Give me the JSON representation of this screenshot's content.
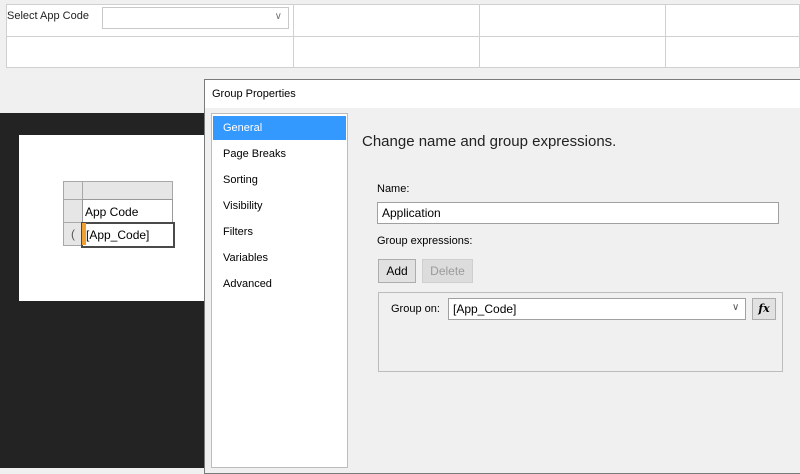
{
  "parameters": {
    "label": "Select App Code",
    "selected_value": ""
  },
  "report": {
    "tablix": {
      "header": "App Code",
      "field": "[App_Code]",
      "group_indicator": "("
    }
  },
  "dialog": {
    "title": "Group Properties",
    "nav": [
      {
        "label": "General",
        "active": true
      },
      {
        "label": "Page Breaks",
        "active": false
      },
      {
        "label": "Sorting",
        "active": false
      },
      {
        "label": "Visibility",
        "active": false
      },
      {
        "label": "Filters",
        "active": false
      },
      {
        "label": "Variables",
        "active": false
      },
      {
        "label": "Advanced",
        "active": false
      }
    ],
    "heading": "Change name and group expressions.",
    "name_label": "Name:",
    "name_value": "Application",
    "group_expressions_label": "Group expressions:",
    "add_label": "Add",
    "delete_label": "Delete",
    "group_on_label": "Group on:",
    "group_on_value": "[App_Code]",
    "fx_label": "fx"
  },
  "colors": {
    "selection": "#3399ff",
    "surface": "#232323",
    "field_marker": "#f0a030"
  },
  "icons": {
    "dropdown": "chevron-down-icon",
    "expression": "fx-icon"
  }
}
